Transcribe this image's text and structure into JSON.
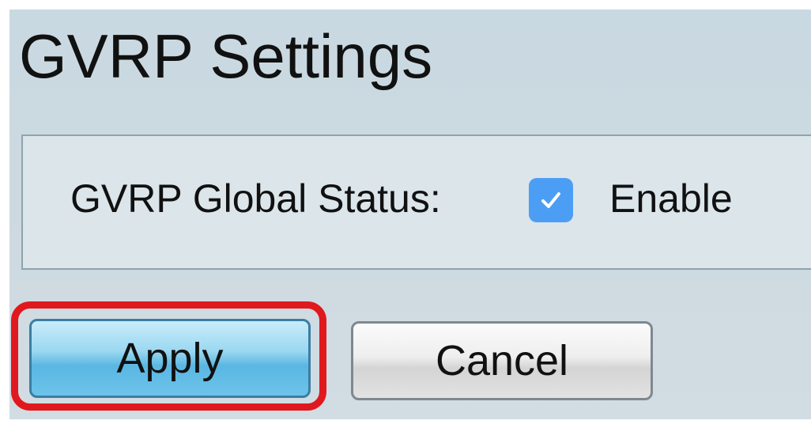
{
  "page": {
    "title": "GVRP Settings"
  },
  "settings": {
    "status_label": "GVRP Global Status:",
    "checkbox_checked": true,
    "checkbox_color": "#4c9ef4",
    "enable_label": "Enable"
  },
  "actions": {
    "apply_label": "Apply",
    "cancel_label": "Cancel",
    "highlight_color": "#e0191e"
  }
}
